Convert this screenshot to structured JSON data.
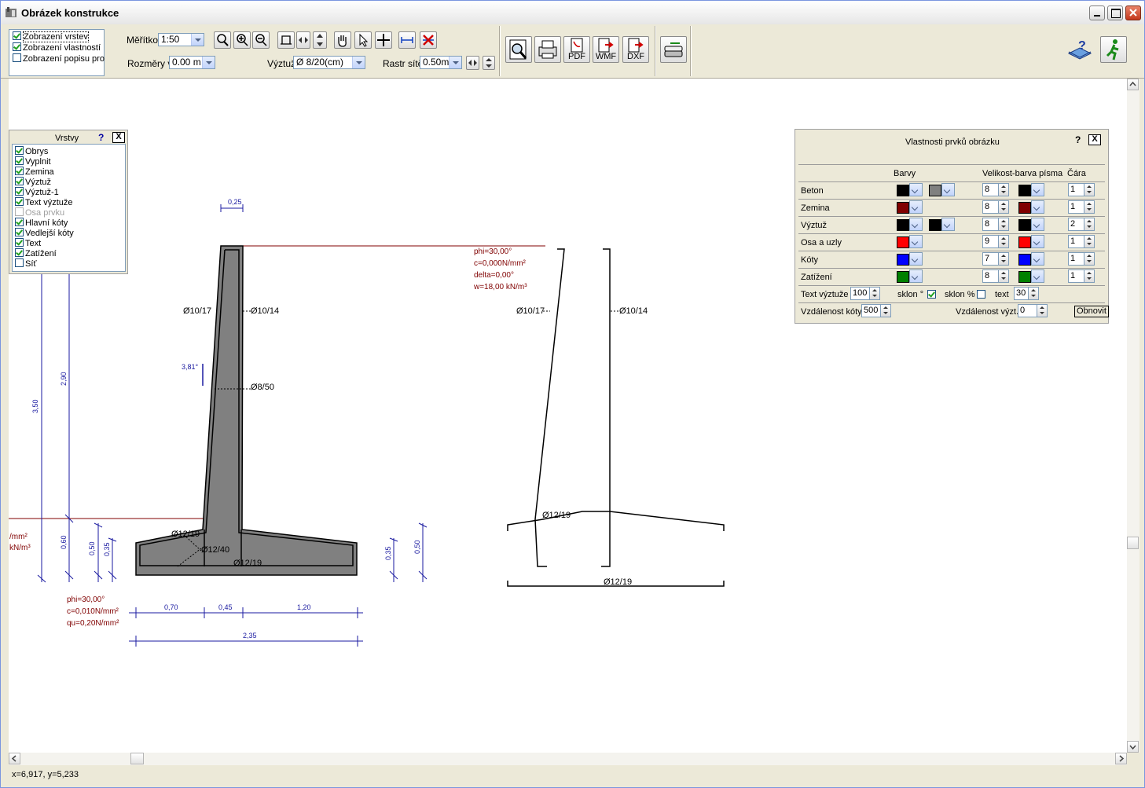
{
  "window": {
    "title": "Obrázek konstrukce"
  },
  "toolbar": {
    "checks": [
      {
        "label": "Zobrazení vrstev",
        "checked": true
      },
      {
        "label": "Zobrazení vlastností",
        "checked": true
      },
      {
        "label": "Zobrazení popisu pro",
        "checked": false
      }
    ],
    "scale_label": "Měřítko",
    "scale_value": "1:50",
    "dims_label": "Rozměry v",
    "dims_value": "0.00 m",
    "rebar_label": "Výztuž",
    "rebar_value": "Ø 8/20(cm)",
    "grid_label": "Rastr sítě",
    "grid_value": "0.50m",
    "btn_pdf": "PDF",
    "btn_wmf": "WMF",
    "btn_dxf": "DXF"
  },
  "layers": {
    "title": "Vrstvy",
    "help": "?",
    "close": "X",
    "items": [
      {
        "label": "Obrys",
        "checked": true
      },
      {
        "label": "Vyplnit",
        "checked": true
      },
      {
        "label": "Zemina",
        "checked": true
      },
      {
        "label": "Výztuž",
        "checked": true
      },
      {
        "label": "Výztuž-1",
        "checked": true
      },
      {
        "label": "Text výztuže",
        "checked": true
      },
      {
        "label": "Osa prvku",
        "checked": false
      },
      {
        "label": "Hlavní kóty",
        "checked": true
      },
      {
        "label": "Vedlejší kóty",
        "checked": true
      },
      {
        "label": "Text",
        "checked": true
      },
      {
        "label": "Zatížení",
        "checked": true
      },
      {
        "label": "Síť",
        "checked": false
      }
    ]
  },
  "props": {
    "title": "Vlastnosti prvků obrázku",
    "help": "?",
    "close": "X",
    "col_colors": "Barvy",
    "col_font": "Velikost-barva písma",
    "col_line": "Čára",
    "rows": [
      {
        "name": "Beton",
        "c1": "#000000",
        "c2": "#808080",
        "size": "8",
        "fc": "#000000",
        "line": "1"
      },
      {
        "name": "Zemina",
        "c1": "#800000",
        "c2": "",
        "size": "8",
        "fc": "#800000",
        "line": "1"
      },
      {
        "name": "Výztuž",
        "c1": "#000000",
        "c2": "#000000",
        "size": "8",
        "fc": "#000000",
        "line": "2"
      },
      {
        "name": "Osa a uzly",
        "c1": "#ff0000",
        "c2": "",
        "size": "9",
        "fc": "#ff0000",
        "line": "1"
      },
      {
        "name": "Kóty",
        "c1": "#0000ff",
        "c2": "",
        "size": "7",
        "fc": "#0000ff",
        "line": "1"
      },
      {
        "name": "Zatížení",
        "c1": "#008000",
        "c2": "",
        "size": "8",
        "fc": "#008000",
        "line": "1"
      }
    ],
    "text_rebar_label": "Text výztuže",
    "text_rebar_value": "100",
    "slope_deg_label": "sklon °",
    "slope_deg_checked": true,
    "slope_pct_label": "sklon %",
    "slope_pct_checked": false,
    "text_label": "text",
    "text_value": "30",
    "dim_dist_label": "Vzdálenost kóty",
    "dim_dist_value": "500",
    "rebar_dist_label": "Vzdálenost výzt.",
    "rebar_dist_value": "0",
    "refresh_label": "Obnovit"
  },
  "drawing": {
    "soil_top": [
      "phi=30,00°",
      "c=0,000N/mm²",
      "delta=0,00°",
      "w=18,00 kN/m³"
    ],
    "soil_left": [
      "/mm²",
      "kN/m³"
    ],
    "soil_base": [
      "phi=30,00°",
      "c=0,010N/mm²",
      "qu=0,20N/mm²"
    ],
    "dims": {
      "top_width": "0,25",
      "h_total": "3,50",
      "h_wall": "2,90",
      "h_base": "0,60",
      "h_b1": "0,50",
      "h_b2": "0,35",
      "r_b2": "0,35",
      "r_b1": "0,50",
      "toe": "0,70",
      "stem": "0,45",
      "heel": "1,20",
      "base": "2,35"
    },
    "rebars": {
      "left": "Ø10/17",
      "right": "Ø10/14",
      "mid": "Ø8/50",
      "base1": "Ø12/19",
      "base2": "Ø12/40",
      "base3": "Ø12/19",
      "angle": "3,81°",
      "d_left": "Ø10/17",
      "d_right": "Ø10/14",
      "d_top": "Ø12/19",
      "d_bottom": "Ø12/19"
    }
  },
  "status": {
    "coords": "x=6,917, y=5,233"
  }
}
